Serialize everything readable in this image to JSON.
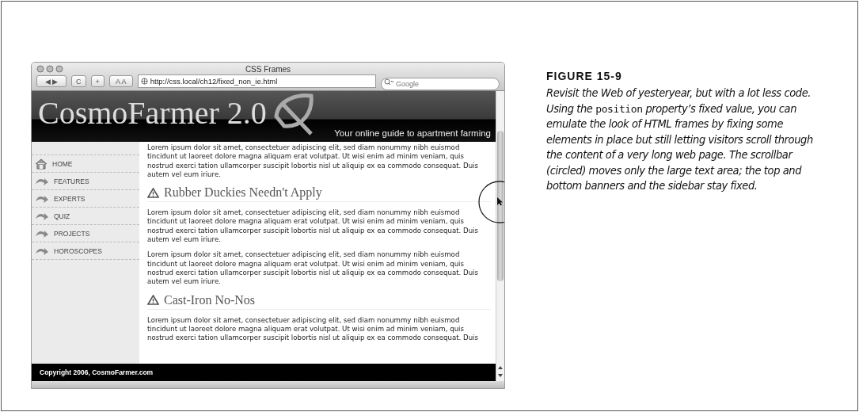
{
  "browser": {
    "title": "CSS Frames",
    "url": "http://css.local/ch12/fixed_non_ie.html",
    "search_placeholder": "Google",
    "buttons": [
      {
        "kind": "backforward",
        "label": "◀ ▶"
      },
      {
        "kind": "reload",
        "label": "C"
      },
      {
        "kind": "add",
        "label": "+"
      },
      {
        "kind": "textsize",
        "label": "A A"
      }
    ]
  },
  "site": {
    "logo": "CosmoFarmer 2.0",
    "tagline": "Your online guide to apartment farming",
    "nav": [
      {
        "label": "HOME",
        "kind": "home"
      },
      {
        "label": "FEATURES",
        "kind": "arrow"
      },
      {
        "label": "EXPERTS",
        "kind": "arrow"
      },
      {
        "label": "QUIZ",
        "kind": "arrow"
      },
      {
        "label": "PROJECTS",
        "kind": "arrow"
      },
      {
        "label": "HOROSCOPES",
        "kind": "arrow"
      }
    ],
    "content": [
      {
        "kind": "paragraph",
        "text": "Lorem ipsum dolor sit amet, consectetuer adipiscing elit, sed diam nonummy nibh euismod tincidunt ut laoreet dolore magna aliquam erat volutpat. Ut wisi enim ad minim veniam, quis nostrud exerci tation ullamcorper suscipit lobortis nisl ut aliquip ex ea commodo consequat. Duis autem vel eum iriure."
      },
      {
        "kind": "heading",
        "text": "Rubber Duckies Needn't Apply"
      },
      {
        "kind": "paragraph",
        "text": "Lorem ipsum dolor sit amet, consectetuer adipiscing elit, sed diam nonummy nibh euismod tincidunt ut laoreet dolore magna aliquam erat volutpat. Ut wisi enim ad minim veniam, quis nostrud exerci tation ullamcorper suscipit lobortis nisl ut aliquip ex ea commodo consequat. Duis autem vel eum iriure."
      },
      {
        "kind": "paragraph",
        "text": "Lorem ipsum dolor sit amet, consectetuer adipiscing elit, sed diam nonummy nibh euismod tincidunt ut laoreet dolore magna aliquam erat volutpat. Ut wisi enim ad minim veniam, quis nostrud exerci tation ullamcorper suscipit lobortis nisl ut aliquip ex ea commodo consequat. Duis autem vel eum iriure."
      },
      {
        "kind": "heading",
        "text": "Cast-Iron No-Nos"
      },
      {
        "kind": "paragraph",
        "text": "Lorem ipsum dolor sit amet, consectetuer adipiscing elit, sed diam nonummy nibh euismod tincidunt ut laoreet dolore magna aliquam erat volutpat. Ut wisi enim ad minim veniam, quis nostrud exerci tation ullamcorper suscipit lobortis nisl ut aliquip ex ea commodo consequat. Duis"
      }
    ],
    "footer": "Copyright 2006, CosmoFarmer.com"
  },
  "caption": {
    "label": "FIGURE 15-9",
    "parts": [
      {
        "kind": "text",
        "text": "Revisit the Web of yesteryear, but with a lot less code. Using the "
      },
      {
        "kind": "code",
        "text": "position"
      },
      {
        "kind": "text",
        "text": " property’s fixed value, you can emulate the look of HTML frames by fixing some elements in place but still letting visitors scroll through the content of a very long web page. The scrollbar (circled) moves only the large text area; the top and bottom banners and the sidebar stay fixed."
      }
    ]
  }
}
